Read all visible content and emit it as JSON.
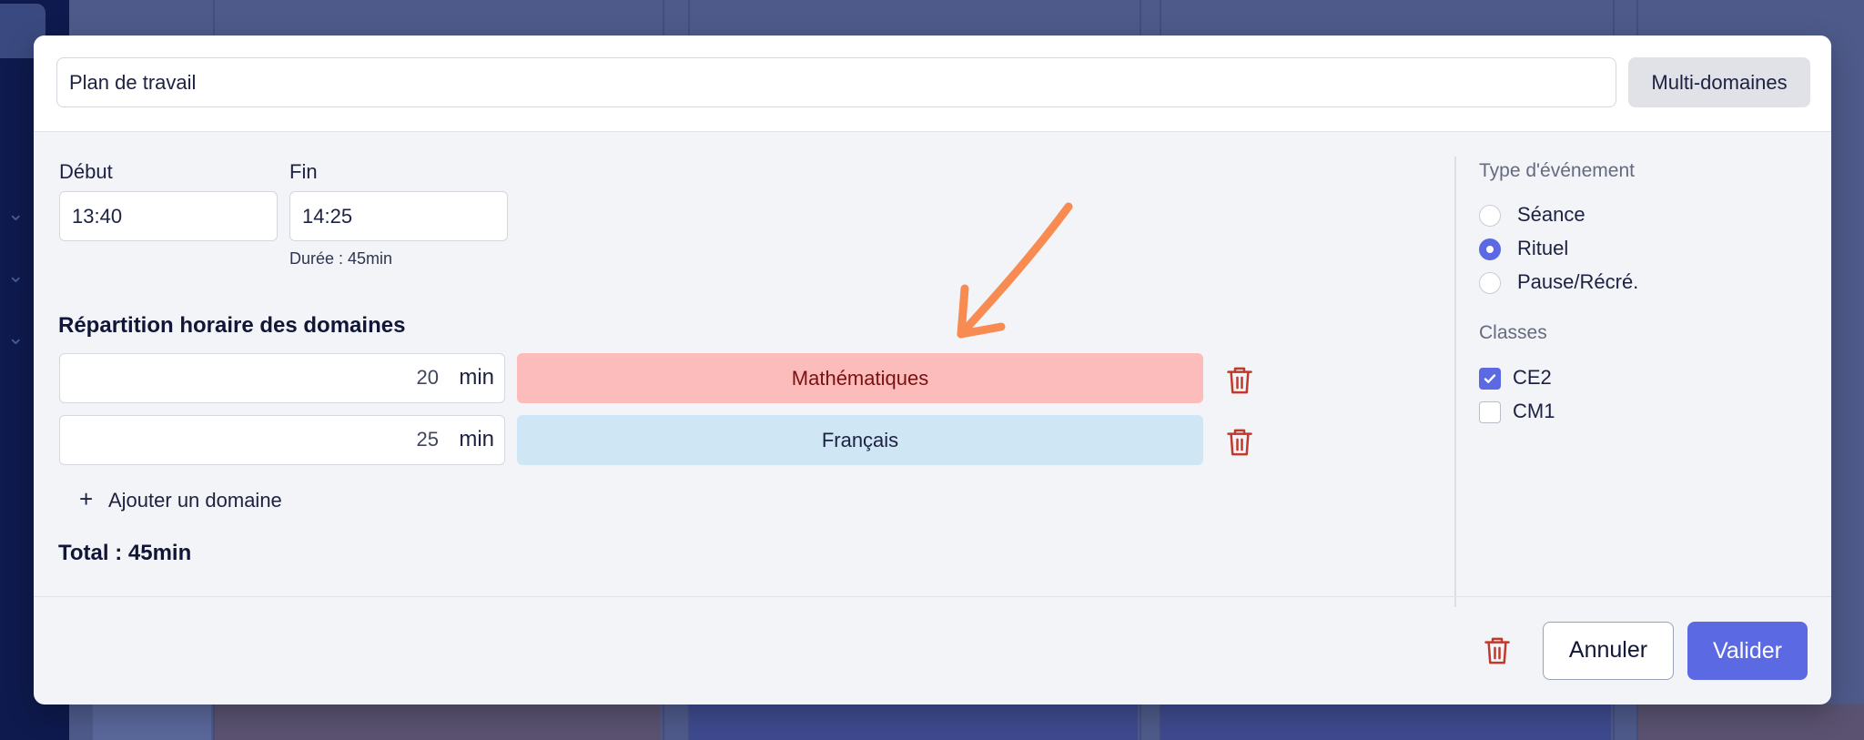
{
  "header": {
    "title_value": "Plan de travail",
    "multi_domains_label": "Multi-domaines"
  },
  "times": {
    "start_label": "Début",
    "start_value": "13:40",
    "end_label": "Fin",
    "end_value": "14:25",
    "duration_text": "Durée : 45min"
  },
  "domains": {
    "section_title": "Répartition horaire des domaines",
    "unit": "min",
    "rows": [
      {
        "minutes": "20",
        "name": "Mathématiques",
        "bg": "#fdbcbc",
        "fg": "#7a1111"
      },
      {
        "minutes": "25",
        "name": "Français",
        "bg": "#cfe6f5",
        "fg": "#1c2142"
      }
    ],
    "add_label": "Ajouter un domaine",
    "total_text": "Total : 45min"
  },
  "event_type": {
    "heading": "Type d'événement",
    "options": [
      {
        "label": "Séance",
        "selected": false
      },
      {
        "label": "Rituel",
        "selected": true
      },
      {
        "label": "Pause/Récré.",
        "selected": false
      }
    ]
  },
  "classes": {
    "heading": "Classes",
    "options": [
      {
        "label": "CE2",
        "checked": true
      },
      {
        "label": "CM1",
        "checked": false
      }
    ]
  },
  "footer": {
    "cancel_label": "Annuler",
    "validate_label": "Valider"
  },
  "colors": {
    "accent": "#5b6ae3",
    "danger": "#c0392b",
    "arrow": "#f78b52"
  }
}
